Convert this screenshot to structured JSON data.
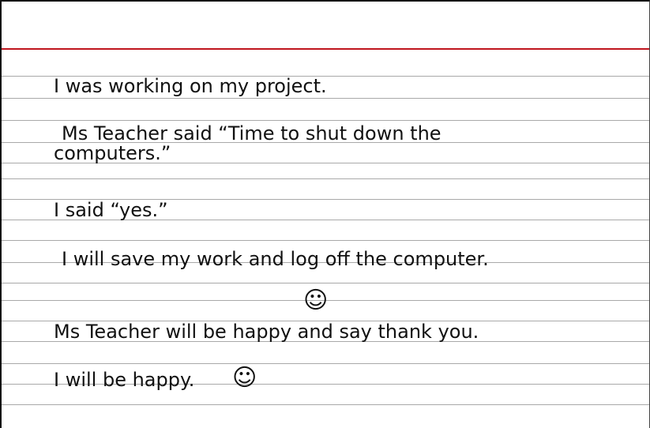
{
  "colors": {
    "margin_line": "#c0151e",
    "rule_lines": "#a9a9a9",
    "text": "#111111"
  },
  "lines": [
    "I was working on my project.",
    "Ms Teacher said “Time to shut down the",
    "computers.”",
    "I said “yes.”",
    "I will save my work and log off the computer.",
    "Ms Teacher will be happy and say thank you.",
    "I will be happy."
  ],
  "smiley": "☺",
  "icons": [
    "smiley-face-icon",
    "smiley-face-icon"
  ]
}
